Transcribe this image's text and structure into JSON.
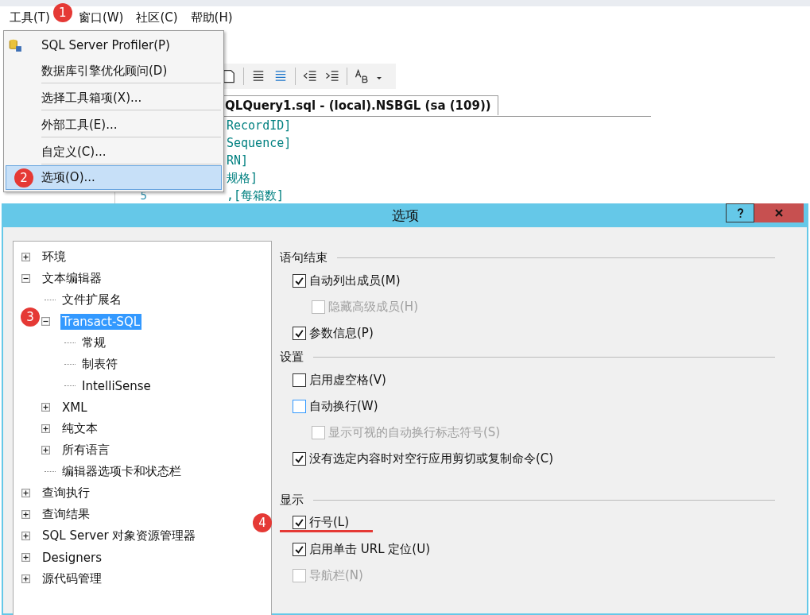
{
  "menubar": [
    {
      "label": "工具(T)",
      "badge": "1"
    },
    {
      "label": "窗口(W)"
    },
    {
      "label": "社区(C)"
    },
    {
      "label": "帮助(H)"
    }
  ],
  "menu": {
    "items": [
      {
        "label": "SQL Server Profiler(P)",
        "icon": true,
        "separator_after": false,
        "selected": false
      },
      {
        "label": "数据库引擎优化顾问(D)",
        "separator_after": true,
        "selected": false
      },
      {
        "label": "选择工具箱项(X)...",
        "separator_after": true,
        "selected": false
      },
      {
        "label": "外部工具(E)...",
        "separator_after": true,
        "selected": false
      },
      {
        "label": "自定义(C)...",
        "separator_after": true,
        "selected": false
      },
      {
        "label": "选项(O)...",
        "separator_after": false,
        "selected": true,
        "badge": "2"
      }
    ]
  },
  "editor": {
    "tab_title": "QLQuery1.sql - (local).NSBGL (sa (109))",
    "code_lines": [
      {
        "text": "RecordID]"
      },
      {
        "text": "Sequence]"
      },
      {
        "text": "RN]"
      },
      {
        "text": "规格]"
      },
      {
        "text": ",[每箱数]",
        "number": "5"
      }
    ]
  },
  "dialog": {
    "title": "选项",
    "tree": [
      {
        "label": "环境",
        "expanded": false
      },
      {
        "label": "文本编辑器",
        "expanded": true,
        "children": [
          {
            "label": "文件扩展名"
          },
          {
            "label": "Transact-SQL",
            "expanded": true,
            "selected": true,
            "badge": "3",
            "children": [
              {
                "label": "常规"
              },
              {
                "label": "制表符"
              },
              {
                "label": "IntelliSense"
              }
            ]
          },
          {
            "label": "XML",
            "expanded": false
          },
          {
            "label": "纯文本",
            "expanded": false
          },
          {
            "label": "所有语言",
            "expanded": false
          },
          {
            "label": "编辑器选项卡和状态栏"
          }
        ]
      },
      {
        "label": "查询执行",
        "expanded": false
      },
      {
        "label": "查询结果",
        "expanded": false
      },
      {
        "label": "SQL Server 对象资源管理器",
        "expanded": false
      },
      {
        "label": "Designers",
        "expanded": false
      },
      {
        "label": "源代码管理",
        "expanded": false
      }
    ],
    "sections": [
      {
        "title": "语句结束",
        "options": [
          {
            "label": "自动列出成员(M)",
            "checked": true,
            "disabled": false,
            "children": [
              {
                "label": "隐藏高级成员(H)",
                "checked": false,
                "disabled": true
              }
            ]
          },
          {
            "label": "参数信息(P)",
            "checked": true,
            "disabled": false
          }
        ]
      },
      {
        "title": "设置",
        "options": [
          {
            "label": "启用虚空格(V)",
            "checked": false,
            "disabled": false
          },
          {
            "label": "自动换行(W)",
            "checked": false,
            "disabled": false,
            "focused": true,
            "children": [
              {
                "label": "显示可视的自动换行标志符号(S)",
                "checked": false,
                "disabled": true
              }
            ]
          },
          {
            "label": "没有选定内容时对空行应用剪切或复制命令(C)",
            "checked": true,
            "disabled": false
          }
        ]
      },
      {
        "title": "显示",
        "options": [
          {
            "label": "行号(L)",
            "checked": true,
            "disabled": false,
            "badge": "4",
            "underlined": true
          },
          {
            "label": "启用单击 URL 定位(U)",
            "checked": true,
            "disabled": false
          },
          {
            "label": "导航栏(N)",
            "checked": false,
            "disabled": true
          }
        ]
      }
    ]
  }
}
